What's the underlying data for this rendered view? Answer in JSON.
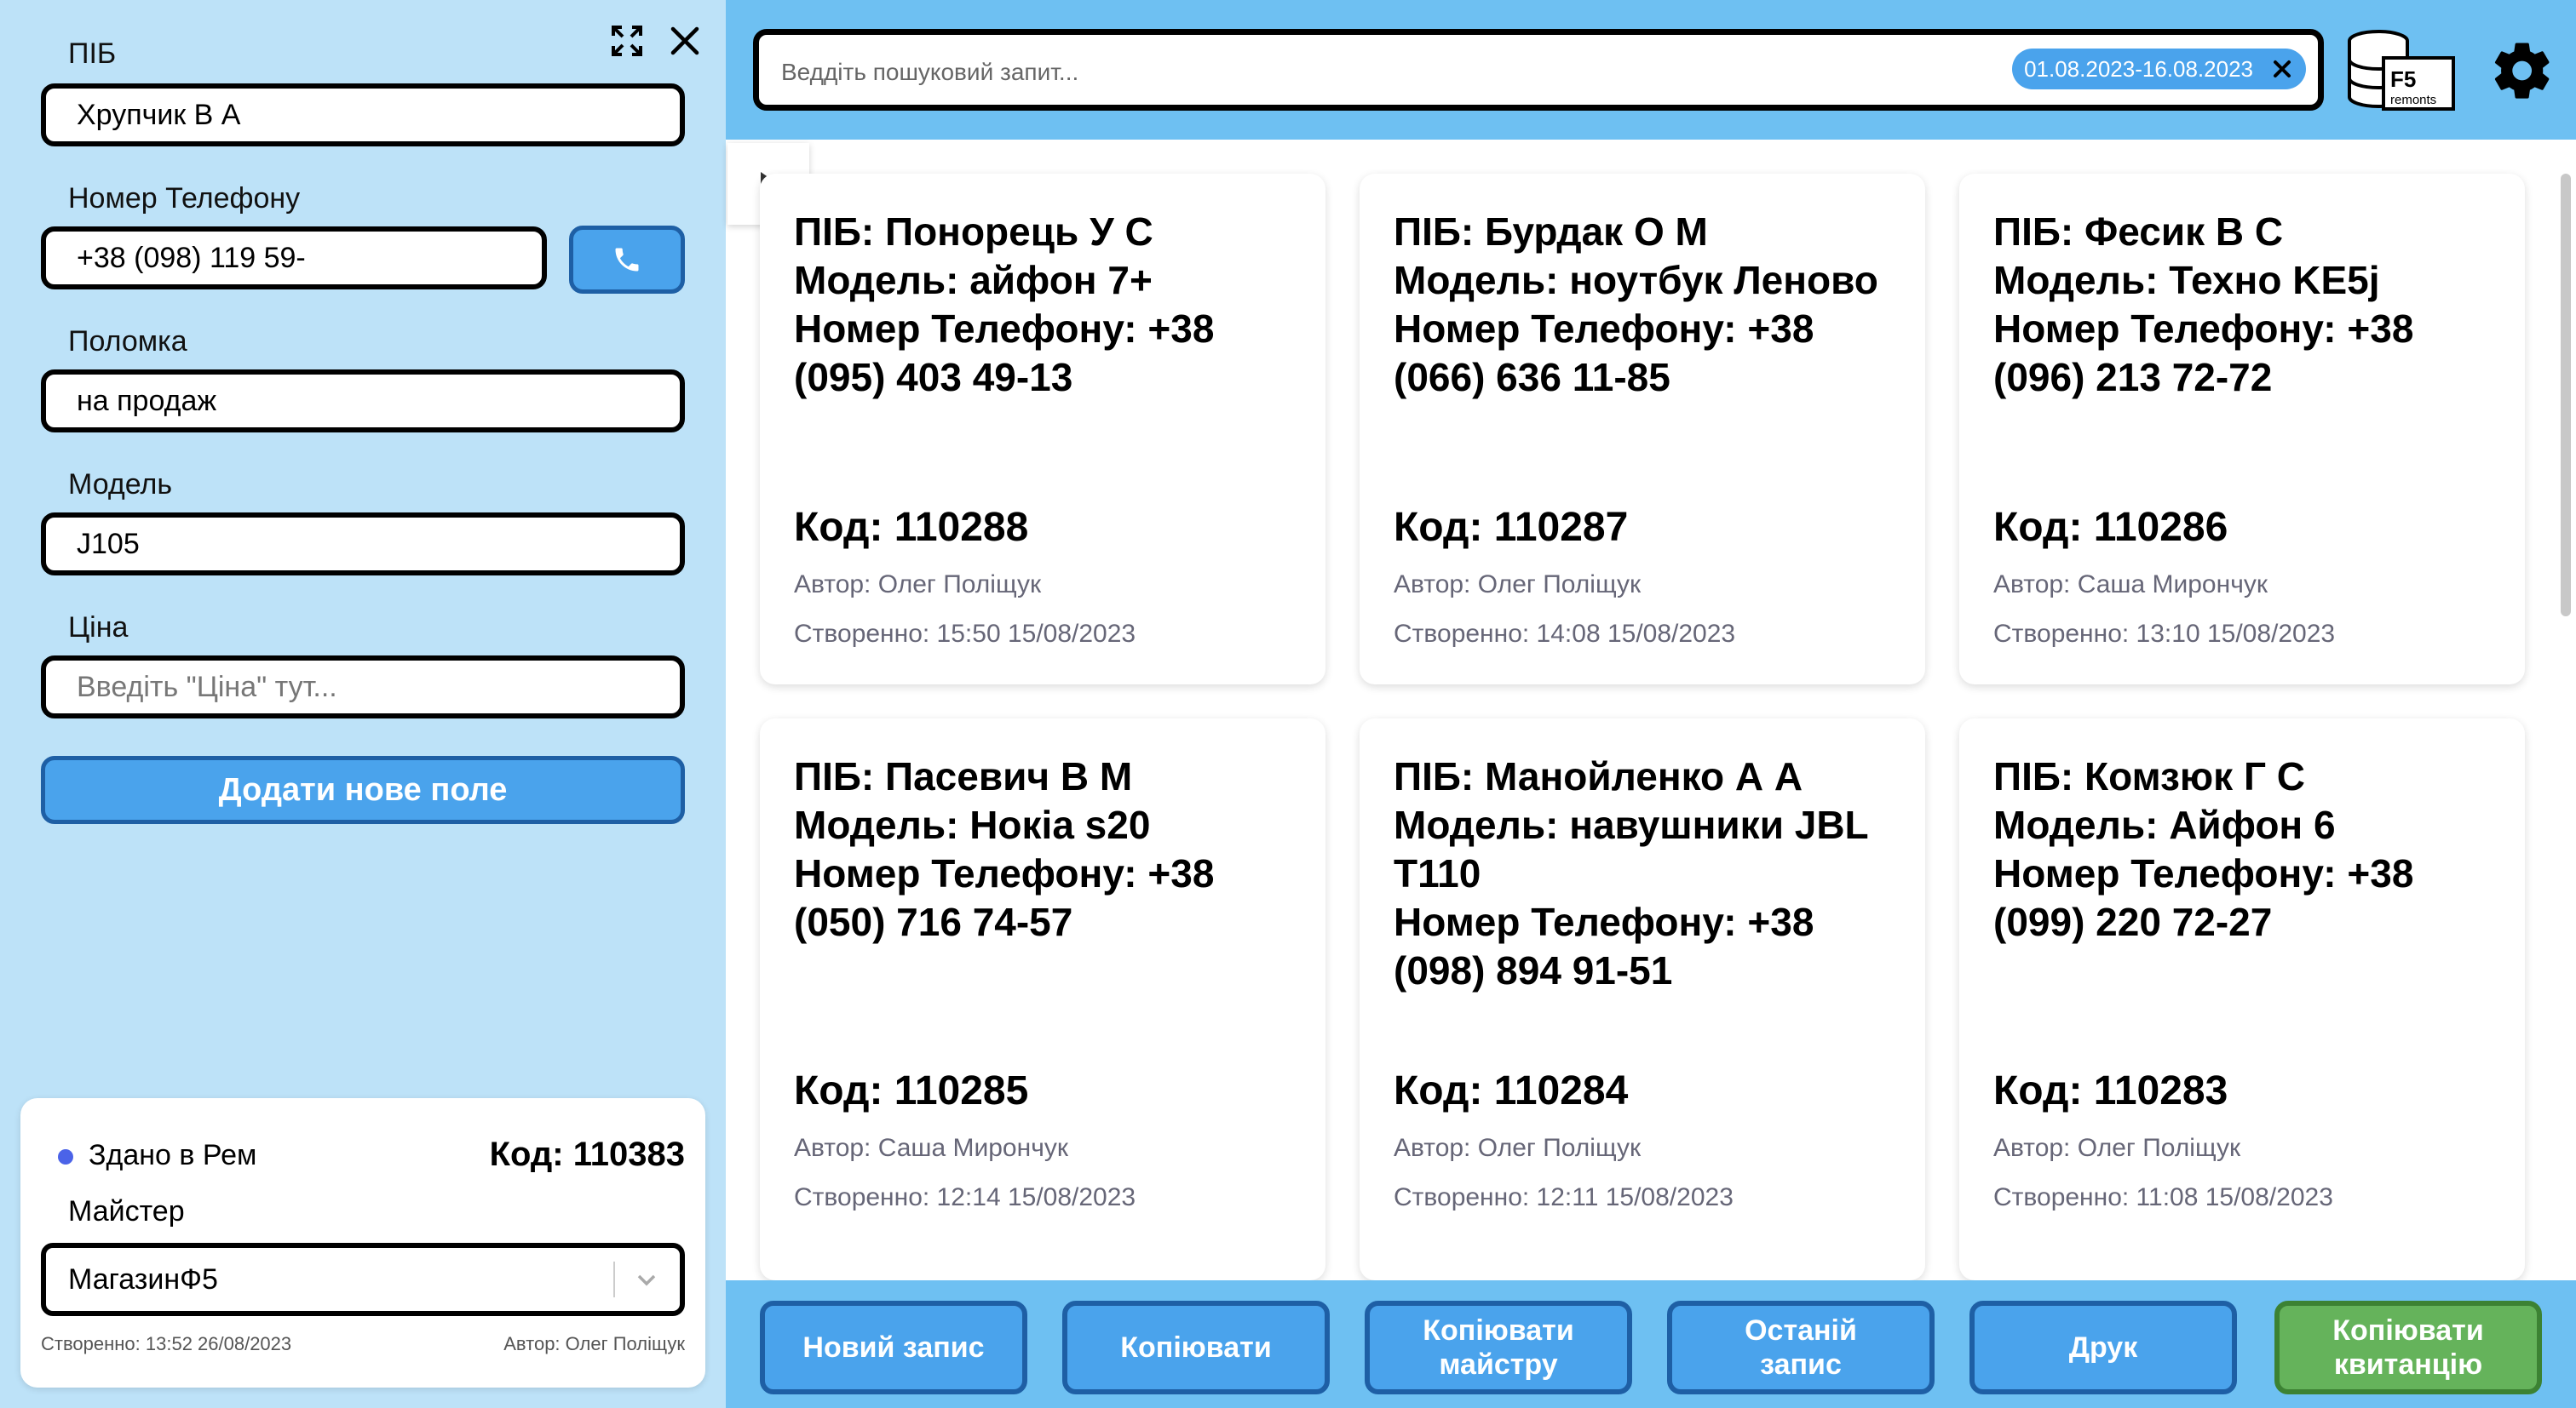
{
  "form": {
    "name_label": "ПІБ",
    "name_value": "Хрупчик В А",
    "phone_label": "Номер Телефону",
    "phone_value": "+38 (098) 119 59-",
    "issue_label": "Поломка",
    "issue_value": "на продаж",
    "model_label": "Модель",
    "model_value": "J105",
    "price_label": "Ціна",
    "price_placeholder": "Введіть \"Ціна\" тут...",
    "add_field_label": "Додати нове поле"
  },
  "status_card": {
    "status": "Здано в Рем",
    "status_color": "#4b63e8",
    "code": "Код: 110383",
    "master_label": "Майстер",
    "master_value": "МагазинФ5",
    "created": "Створенно: 13:52 26/08/2023",
    "author": "Автор: Олег Поліщук"
  },
  "search": {
    "placeholder": "Веддіть пошуковий запит...",
    "date_range": "01.08.2023-16.08.2023"
  },
  "logo": {
    "text": "F5",
    "sub": "remonts"
  },
  "records": [
    {
      "title": "ПІБ: Понорець У С\nМодель: айфон 7+\nНомер Телефону: +38\n(095) 403 49-13",
      "code": "Код: 110288",
      "author": "Автор: Олег Поліщук",
      "created": "Створенно: 15:50 15/08/2023"
    },
    {
      "title": "ПІБ: Бурдак О М\nМодель: ноутбук Леново\nНомер Телефону: +38\n(066) 636 11-85",
      "code": "Код: 110287",
      "author": "Автор: Олег Поліщук",
      "created": "Створенно: 14:08 15/08/2023"
    },
    {
      "title": "ПІБ: Фесик В С\nМодель: Техно KE5j\nНомер Телефону: +38\n(096) 213 72-72",
      "code": "Код: 110286",
      "author": "Автор: Саша Мирончук",
      "created": "Створенно: 13:10 15/08/2023"
    },
    {
      "title": "ПІБ: Пасевич В М\nМодель: Нокіа s20\nНомер Телефону: +38\n(050) 716 74-57",
      "code": "Код: 110285",
      "author": "Автор: Саша Мирончук",
      "created": "Створенно: 12:14 15/08/2023"
    },
    {
      "title": "ПІБ: Манойленко А А\nМодель: навушники JBL\nT110\nНомер Телефону: +38\n(098) 894 91-51",
      "code": "Код: 110284",
      "author": "Автор: Олег Поліщук",
      "created": "Створенно: 12:11 15/08/2023"
    },
    {
      "title": "ПІБ: Комзюк Г С\nМодель: Айфон 6\nНомер Телефону: +38\n(099) 220 72-27",
      "code": "Код: 110283",
      "author": "Автор: Олег Поліщук",
      "created": "Створенно: 11:08 15/08/2023"
    }
  ],
  "actions": {
    "new_record": "Новий запис",
    "copy": "Копіювати",
    "copy_master": "Копіювати\nмайстру",
    "last_record": "Останій\nзапис",
    "print": "Друк",
    "copy_receipt": "Копіювати\nквитанцію"
  },
  "icons": {
    "fullscreen": "fullscreen-icon",
    "close": "close-icon",
    "phone": "phone-icon",
    "clear": "clear-icon",
    "settings": "gear-icon",
    "collapse": "chevron-right-icon",
    "dropdown": "chevron-down-icon"
  }
}
